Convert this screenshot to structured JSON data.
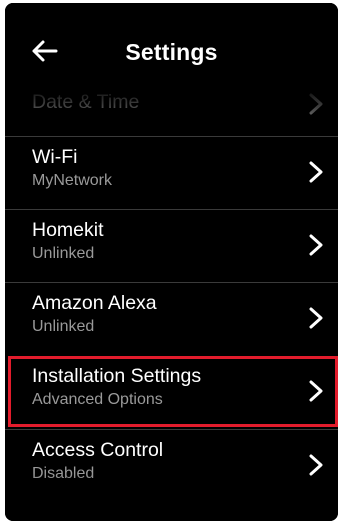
{
  "header": {
    "title": "Settings",
    "back_icon": "arrow-left-icon"
  },
  "settings": {
    "items": [
      {
        "title": "Date & Time",
        "subtitle": ""
      },
      {
        "title": "Wi-Fi",
        "subtitle": "MyNetwork"
      },
      {
        "title": "Homekit",
        "subtitle": "Unlinked"
      },
      {
        "title": "Amazon Alexa",
        "subtitle": "Unlinked"
      },
      {
        "title": "Installation Settings",
        "subtitle": "Advanced Options"
      },
      {
        "title": "Access Control",
        "subtitle": "Disabled"
      }
    ],
    "chevron_icon": "chevron-right-icon",
    "highlighted_item": "Installation Settings"
  },
  "colors": {
    "background": "#000000",
    "text_primary": "#ffffff",
    "text_secondary": "#9a9a9a",
    "highlight": "#e21c2c"
  }
}
